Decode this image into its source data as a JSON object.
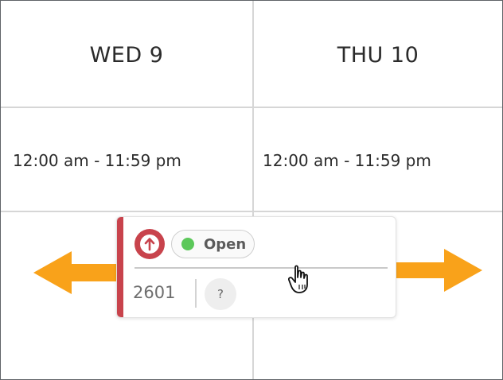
{
  "schedule": {
    "days": [
      {
        "header": "WED 9",
        "hours": "12:00 am - 11:59 pm"
      },
      {
        "header": "THU 10",
        "hours": "12:00 am - 11:59 pm"
      }
    ]
  },
  "shift": {
    "priority_icon": "arrow-up-circle-icon",
    "status": "Open",
    "status_color": "#5cc85a",
    "accent_color": "#c8434c",
    "number": "2601",
    "assignee": "?"
  },
  "icons": {
    "left_arrow": "arrow-left-icon",
    "right_arrow": "arrow-right-icon",
    "cursor": "hand-pointer-icon"
  },
  "colors": {
    "arrow": "#f9a21a",
    "grid": "#d6d6d6"
  }
}
